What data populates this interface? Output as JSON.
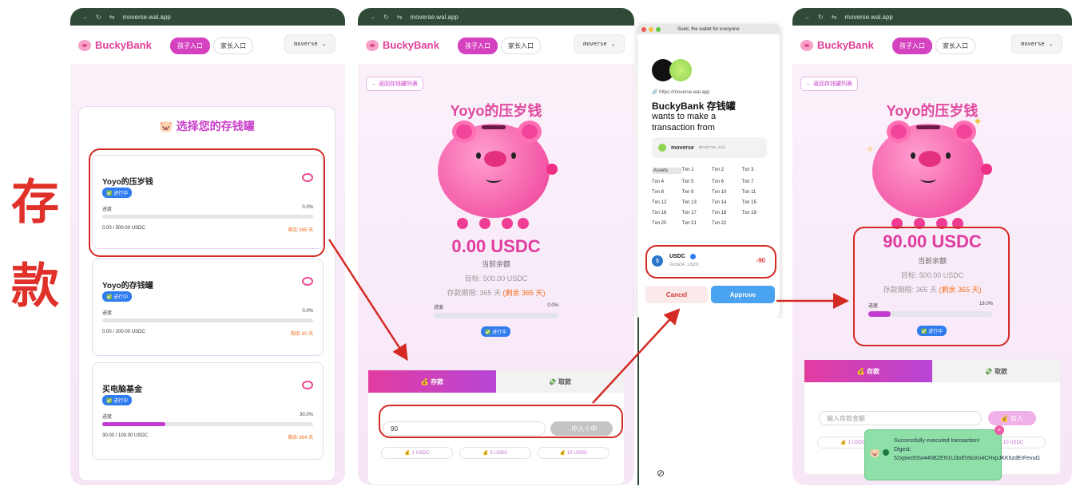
{
  "caption": {
    "chars": [
      "存",
      "款"
    ]
  },
  "url": "moverse.wal.app",
  "app": {
    "name": "BuckyBank",
    "tab_child": "孩子入口",
    "tab_parent": "家长入口",
    "account": "moverse"
  },
  "select": {
    "title": "选择您的存钱罐",
    "progress_label": "进度",
    "jars": [
      {
        "name": "Yoyo的压岁钱",
        "status": "进行中",
        "percent": "0.0%",
        "fill": 0.0,
        "amount": "0.00 / 500.00 USDC",
        "remaining": "剩余 365 天"
      },
      {
        "name": "Yoyo的存钱罐",
        "status": "进行中",
        "percent": "0.0%",
        "fill": 0.0,
        "amount": "0.00 / 200.00 USDC",
        "remaining": "剩余 60 天"
      },
      {
        "name": "买电脑基金",
        "status": "进行中",
        "percent": "30.0%",
        "fill": 0.3,
        "amount": "30.00 / 100.00 USDC",
        "remaining": "剩余 364 天"
      }
    ]
  },
  "detail": {
    "back": "← 返回存钱罐列表",
    "title": "Yoyo的压岁钱",
    "balance_before": "0.00 USDC",
    "balance_after": "90.00 USDC",
    "balance_label": "当前余额",
    "target": "目标: 500.00 USDC",
    "period": "存款期限: 365 天",
    "remaining": "(剩余 365 天)",
    "progress_label": "进度",
    "percent_before": "0.0%",
    "percent_after": "18.0%",
    "fill_before": 0.0,
    "fill_after": 0.18,
    "status": "进行中",
    "deposit_tab": "💰 存款",
    "withdraw_tab": "💸 取款",
    "input_value": "90",
    "input_placeholder": "输入存款金额",
    "deposit_btn_loading": "...中入ぐ中",
    "deposit_btn": "💰 存入",
    "quick": [
      "💰 1 USDC",
      "💰 5 USDC",
      "💰 10 USDC"
    ]
  },
  "wallet": {
    "window_title": "Suiet, the wallet for everyone",
    "site": "https://moverse.wal.app",
    "app_title": "BuckyBank 存钱罐",
    "wants": "wants to make a",
    "from": "transaction from",
    "account_name": "moverse",
    "account_addr": "moverse.sui",
    "tabs": [
      "Assets",
      "Txn 1",
      "Txn 2",
      "Txn 3",
      "Txn 4",
      "Txn 5",
      "Txn 6",
      "Txn 7",
      "Txn 8",
      "Txn 9",
      "Txn 10",
      "Txn 11",
      "Txn 12",
      "Txn 13",
      "Txn 14",
      "Txn 15",
      "Txn 16",
      "Txn 17",
      "Txn 18",
      "Txn 19",
      "Txn 20",
      "Txn 21",
      "Txn 22"
    ],
    "coin": "USDC",
    "coin_addr": "0xcba34...USDC",
    "coin_delta": "-90",
    "cancel": "Cancel",
    "approve": "Approve"
  },
  "toast": {
    "text": "Successfully executed transaction! Digest: 52xpws5Sw44hBZEN1U3oEh9oXn4CHxpJKK6zdErFevuG"
  }
}
